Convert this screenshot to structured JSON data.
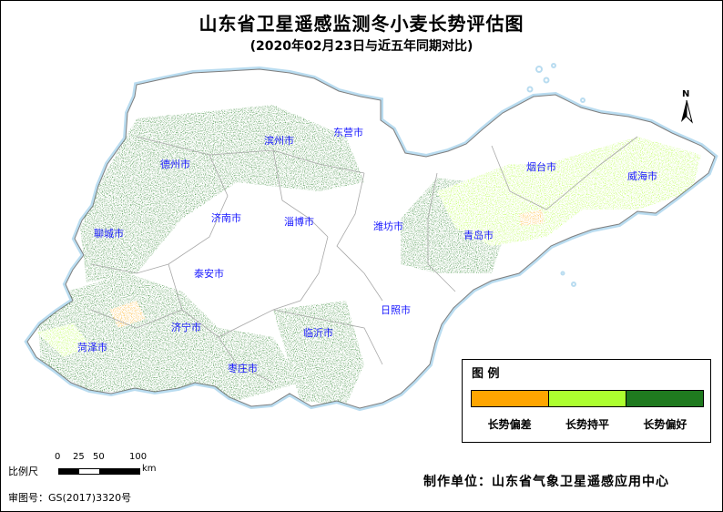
{
  "title": "山东省卫星遥感监测冬小麦长势评估图",
  "subtitle": "(2020年02月23日与近五年同期对比)",
  "north_label": "N",
  "cities": [
    {
      "name": "滨州市"
    },
    {
      "name": "东营市"
    },
    {
      "name": "德州市"
    },
    {
      "name": "烟台市"
    },
    {
      "name": "威海市"
    },
    {
      "name": "济南市"
    },
    {
      "name": "淄博市"
    },
    {
      "name": "潍坊市"
    },
    {
      "name": "聊城市"
    },
    {
      "name": "青岛市"
    },
    {
      "name": "泰安市"
    },
    {
      "name": "日照市"
    },
    {
      "name": "济宁市"
    },
    {
      "name": "临沂市"
    },
    {
      "name": "菏泽市"
    },
    {
      "name": "枣庄市"
    }
  ],
  "legend": {
    "title": "图  例",
    "items": [
      {
        "label": "长势偏差",
        "color": "#ffa500"
      },
      {
        "label": "长势持平",
        "color": "#adff2f"
      },
      {
        "label": "长势偏好",
        "color": "#1f7a1f"
      }
    ]
  },
  "scale": {
    "label": "比例尺",
    "ticks": [
      "0",
      "25",
      "50",
      "100"
    ],
    "unit": "km"
  },
  "review_number": "审图号：GS(2017)3320号",
  "producer": "制作单位：山东省气象卫星遥感应用中心",
  "colors": {
    "land": "#ffffff",
    "sea_edge": "#b9dcf0",
    "boundary": "#a0a0a0",
    "city_label": "#1a1aff"
  }
}
